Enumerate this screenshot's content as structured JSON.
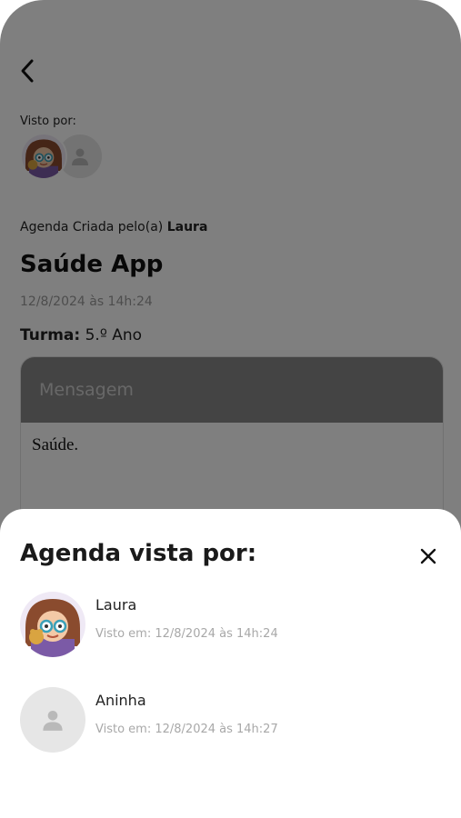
{
  "agenda": {
    "seen_by_label": "Visto por:",
    "created_by_prefix": "Agenda Criada pelo(a)",
    "created_by_name": "Laura",
    "title": "Saúde App",
    "datetime": "12/8/2024 às 14h:24",
    "turma_label": "Turma:",
    "turma_value": "5.º Ano",
    "message_header": "Mensagem",
    "message_body": "Saúde."
  },
  "sheet": {
    "title": "Agenda vista por:",
    "viewers": [
      {
        "name": "Laura",
        "seen_at": "Visto em: 12/8/2024 às 14h:24",
        "avatar": "cartoon-girl-avatar"
      },
      {
        "name": "Aninha",
        "seen_at": "Visto em: 12/8/2024 às 14h:27",
        "avatar": "person-placeholder-icon"
      }
    ]
  },
  "icons": {
    "back": "chevron-left-icon",
    "close": "close-icon",
    "placeholder": "person-placeholder-icon"
  },
  "colors": {
    "overlay": "#000000",
    "text": "#222222",
    "muted": "#a8a8a8",
    "message_header": "#888888",
    "avatar_placeholder": "#e6e6e6"
  }
}
